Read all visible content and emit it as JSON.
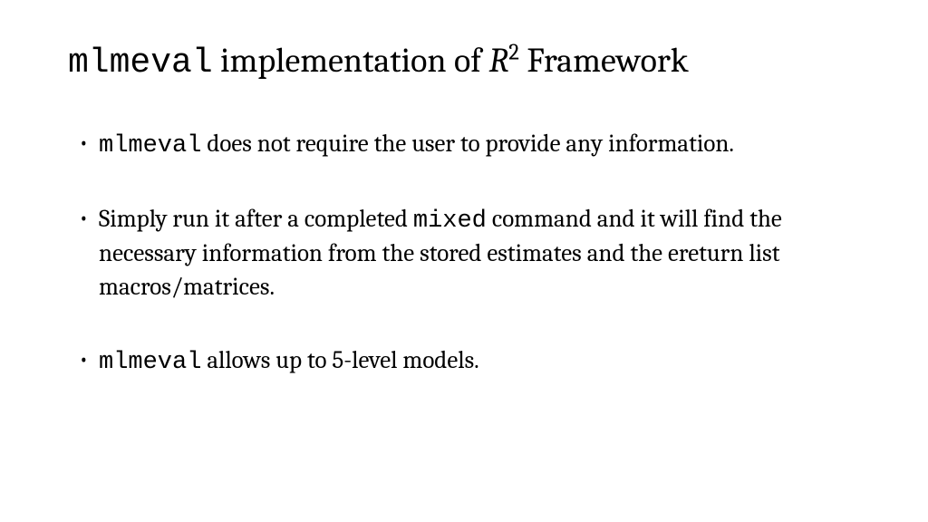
{
  "title": {
    "code": "mlmeval",
    "middle": " implementation of ",
    "r": "R",
    "sup": "2",
    "after": " Framework"
  },
  "bullets": [
    {
      "code1": "mlmeval",
      "text1": " does not require the user to provide any information."
    },
    {
      "text_a": "Simply run it after a completed ",
      "code_a": "mixed",
      "text_b": " command and it will find the necessary information from the stored estimates and the ereturn list macros/matrices."
    },
    {
      "code1": "mlmeval",
      "text1": " allows up to 5-level models."
    }
  ]
}
